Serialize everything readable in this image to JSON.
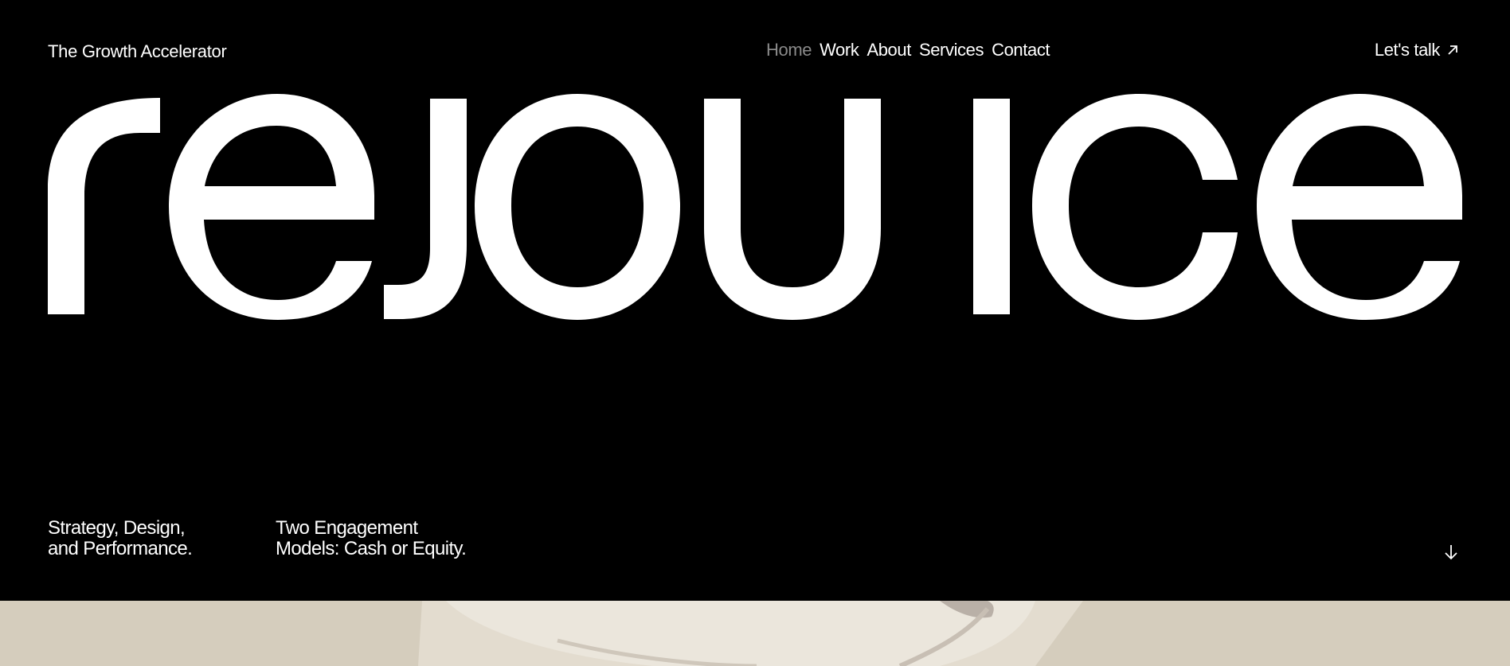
{
  "header": {
    "brand": "The Growth Accelerator",
    "nav": [
      {
        "label": "Home",
        "active": true
      },
      {
        "label": "Work",
        "active": false
      },
      {
        "label": "About",
        "active": false
      },
      {
        "label": "Services",
        "active": false
      },
      {
        "label": "Contact",
        "active": false
      }
    ],
    "cta_label": "Let's talk",
    "cta_icon": "arrow-up-right-icon"
  },
  "hero": {
    "logo_text": "rejouice",
    "tagline_1": {
      "line1": "Strategy, Design,",
      "line2": "and Performance."
    },
    "tagline_2": {
      "line1": "Two Engagement",
      "line2": "Models: Cash or Equity."
    },
    "scroll_icon": "arrow-down-icon"
  },
  "colors": {
    "background": "#000000",
    "text": "#ffffff",
    "nav_active": "#8a8a8a",
    "media_background": "#d5cdbd"
  }
}
